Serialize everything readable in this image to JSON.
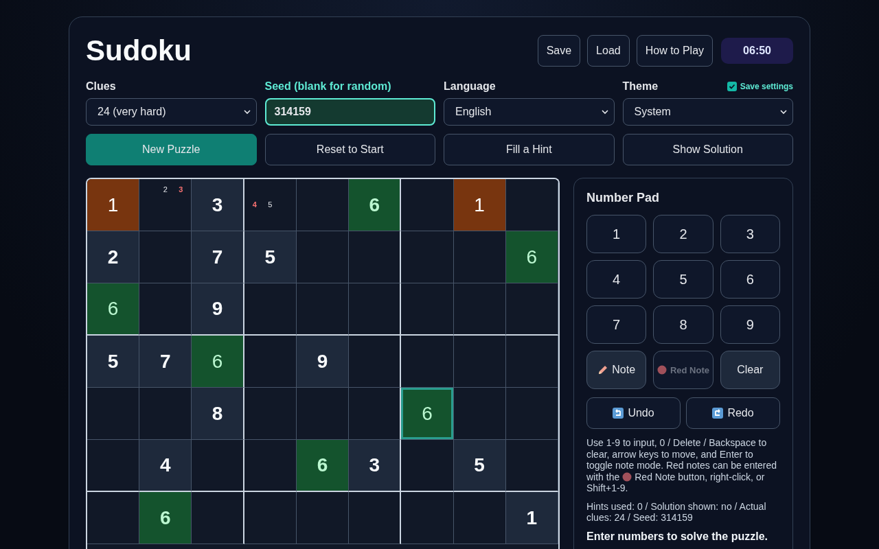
{
  "title": "Sudoku",
  "header_buttons": [
    "Save",
    "Load",
    "How to Play"
  ],
  "timer": "06:50",
  "settings": [
    {
      "kind": "select",
      "label": "Clues",
      "value": "24 (very hard)",
      "focused": false
    },
    {
      "kind": "input",
      "label": "Seed (blank for random)",
      "value": "314159",
      "focused": true
    },
    {
      "kind": "select",
      "label": "Language",
      "value": "English",
      "focused": false
    },
    {
      "kind": "select",
      "label": "Theme",
      "value": "System",
      "focused": false
    }
  ],
  "save_settings": {
    "label": "Save settings",
    "checked": true
  },
  "actions": [
    {
      "label": "New Puzzle",
      "primary": true
    },
    {
      "label": "Reset to Start",
      "primary": false
    },
    {
      "label": "Fill a Hint",
      "primary": false
    },
    {
      "label": "Show Solution",
      "primary": false
    }
  ],
  "board": [
    [
      {
        "kind": "entry",
        "value": "1",
        "same_digit": false,
        "conflict": true,
        "selected": false
      },
      {
        "kind": "notes",
        "notes": [
          {
            "digit": "2",
            "red": false
          },
          {
            "digit": "3",
            "red": true
          }
        ]
      },
      {
        "kind": "given",
        "value": "3",
        "same_digit": false,
        "conflict": false,
        "selected": false
      },
      {
        "kind": "notes",
        "notes": [
          {
            "digit": "4",
            "red": true
          },
          {
            "digit": "5",
            "red": false
          }
        ]
      },
      {
        "kind": "empty"
      },
      {
        "kind": "given",
        "value": "6",
        "same_digit": true,
        "conflict": false,
        "selected": false
      },
      {
        "kind": "empty"
      },
      {
        "kind": "entry",
        "value": "1",
        "same_digit": false,
        "conflict": true,
        "selected": false
      },
      {
        "kind": "empty"
      }
    ],
    [
      {
        "kind": "given",
        "value": "2",
        "same_digit": false,
        "conflict": false,
        "selected": false
      },
      {
        "kind": "empty"
      },
      {
        "kind": "given",
        "value": "7",
        "same_digit": false,
        "conflict": false,
        "selected": false
      },
      {
        "kind": "given",
        "value": "5",
        "same_digit": false,
        "conflict": false,
        "selected": false
      },
      {
        "kind": "empty"
      },
      {
        "kind": "empty"
      },
      {
        "kind": "empty"
      },
      {
        "kind": "empty"
      },
      {
        "kind": "entry",
        "value": "6",
        "same_digit": true,
        "conflict": false,
        "selected": false
      }
    ],
    [
      {
        "kind": "entry",
        "value": "6",
        "same_digit": true,
        "conflict": false,
        "selected": false
      },
      {
        "kind": "empty"
      },
      {
        "kind": "given",
        "value": "9",
        "same_digit": false,
        "conflict": false,
        "selected": false
      },
      {
        "kind": "empty"
      },
      {
        "kind": "empty"
      },
      {
        "kind": "empty"
      },
      {
        "kind": "empty"
      },
      {
        "kind": "empty"
      },
      {
        "kind": "empty"
      }
    ],
    [
      {
        "kind": "given",
        "value": "5",
        "same_digit": false,
        "conflict": false,
        "selected": false
      },
      {
        "kind": "given",
        "value": "7",
        "same_digit": false,
        "conflict": false,
        "selected": false
      },
      {
        "kind": "entry",
        "value": "6",
        "same_digit": true,
        "conflict": false,
        "selected": false
      },
      {
        "kind": "empty"
      },
      {
        "kind": "given",
        "value": "9",
        "same_digit": false,
        "conflict": false,
        "selected": false
      },
      {
        "kind": "empty"
      },
      {
        "kind": "empty"
      },
      {
        "kind": "empty"
      },
      {
        "kind": "empty"
      }
    ],
    [
      {
        "kind": "empty"
      },
      {
        "kind": "empty"
      },
      {
        "kind": "given",
        "value": "8",
        "same_digit": false,
        "conflict": false,
        "selected": false
      },
      {
        "kind": "empty"
      },
      {
        "kind": "empty"
      },
      {
        "kind": "empty"
      },
      {
        "kind": "entry",
        "value": "6",
        "same_digit": true,
        "conflict": false,
        "selected": true
      },
      {
        "kind": "empty"
      },
      {
        "kind": "empty"
      }
    ],
    [
      {
        "kind": "empty"
      },
      {
        "kind": "given",
        "value": "4",
        "same_digit": false,
        "conflict": false,
        "selected": false
      },
      {
        "kind": "empty"
      },
      {
        "kind": "empty"
      },
      {
        "kind": "given",
        "value": "6",
        "same_digit": true,
        "conflict": false,
        "selected": false
      },
      {
        "kind": "given",
        "value": "3",
        "same_digit": false,
        "conflict": false,
        "selected": false
      },
      {
        "kind": "empty"
      },
      {
        "kind": "given",
        "value": "5",
        "same_digit": false,
        "conflict": false,
        "selected": false
      },
      {
        "kind": "empty"
      }
    ],
    [
      {
        "kind": "empty"
      },
      {
        "kind": "given",
        "value": "6",
        "same_digit": true,
        "conflict": false,
        "selected": false
      },
      {
        "kind": "empty"
      },
      {
        "kind": "empty"
      },
      {
        "kind": "empty"
      },
      {
        "kind": "empty"
      },
      {
        "kind": "empty"
      },
      {
        "kind": "empty"
      },
      {
        "kind": "given",
        "value": "1",
        "same_digit": false,
        "conflict": false,
        "selected": false
      }
    ]
  ],
  "pad": {
    "title": "Number Pad",
    "digits": [
      "1",
      "2",
      "3",
      "4",
      "5",
      "6",
      "7",
      "8",
      "9"
    ],
    "tools": [
      {
        "kind": "note",
        "label": "Note",
        "active": true
      },
      {
        "kind": "red-note",
        "label": "Red Note",
        "active": false
      },
      {
        "kind": "clear",
        "label": "Clear"
      }
    ],
    "history": [
      {
        "kind": "undo",
        "label": "Undo"
      },
      {
        "kind": "redo",
        "label": "Redo"
      }
    ],
    "help_first": "Use 1-9 to input, 0 / Delete / Backspace to clear, arrow keys to move, and Enter to toggle note mode. Red notes can be entered",
    "help_before_icon": "with the",
    "help_after_icon": "Red Note button, right-click, or",
    "help_last": "Shift+1-9.",
    "stats": "Hints used: 0 / Solution shown: no / Actual clues: 24 / Seed: 314159",
    "status": "Enter numbers to solve the puzzle."
  }
}
